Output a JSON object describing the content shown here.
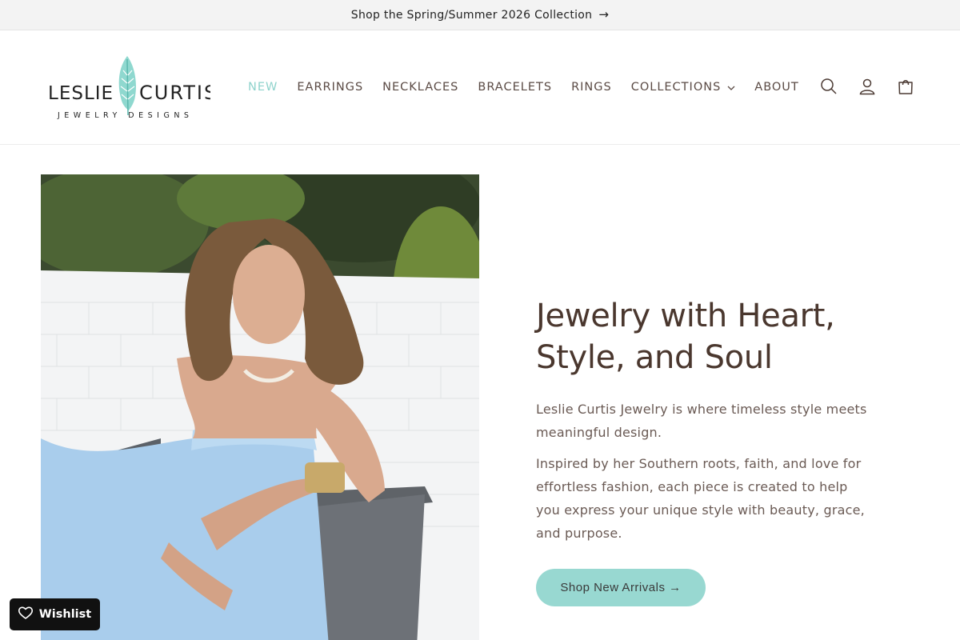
{
  "announcement": {
    "text": "Shop the Spring/Summer 2026 Collection",
    "arrow": "→"
  },
  "logo": {
    "name_left": "LESLIE",
    "name_right": "CURTIS",
    "tagline": "JEWELRY DESIGNS",
    "feather_color": "#8fd8cf"
  },
  "nav": {
    "items": [
      {
        "label": "NEW",
        "active": true
      },
      {
        "label": "EARRINGS"
      },
      {
        "label": "NECKLACES"
      },
      {
        "label": "BRACELETS"
      },
      {
        "label": "RINGS"
      },
      {
        "label": "COLLECTIONS",
        "has_dropdown": true
      },
      {
        "label": "ABOUT"
      }
    ],
    "active_color": "#8fd3cc"
  },
  "header_icons": [
    "search-icon",
    "account-icon",
    "cart-icon"
  ],
  "hero": {
    "title": "Jewelry with Heart, Style, and Soul",
    "paragraph_1": "Leslie Curtis Jewelry is where timeless style meets meaningful design.",
    "paragraph_2": "Inspired by her Southern roots, faith, and love for effortless fashion, each piece is created to help you express your unique style with beauty, grace, and purpose.",
    "cta_label": "Shop New Arrivals →",
    "cta_color": "#98d8d1"
  },
  "wishlist": {
    "label": "Wishlist"
  }
}
